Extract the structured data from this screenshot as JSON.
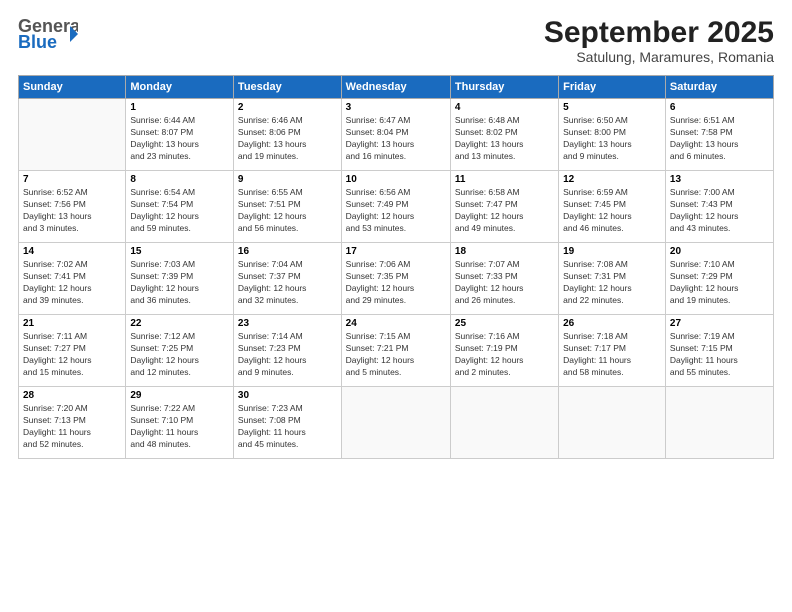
{
  "header": {
    "logo_general": "General",
    "logo_blue": "Blue",
    "title": "September 2025",
    "subtitle": "Satulung, Maramures, Romania"
  },
  "weekdays": [
    "Sunday",
    "Monday",
    "Tuesday",
    "Wednesday",
    "Thursday",
    "Friday",
    "Saturday"
  ],
  "weeks": [
    [
      {
        "day": "",
        "detail": ""
      },
      {
        "day": "1",
        "detail": "Sunrise: 6:44 AM\nSunset: 8:07 PM\nDaylight: 13 hours\nand 23 minutes."
      },
      {
        "day": "2",
        "detail": "Sunrise: 6:46 AM\nSunset: 8:06 PM\nDaylight: 13 hours\nand 19 minutes."
      },
      {
        "day": "3",
        "detail": "Sunrise: 6:47 AM\nSunset: 8:04 PM\nDaylight: 13 hours\nand 16 minutes."
      },
      {
        "day": "4",
        "detail": "Sunrise: 6:48 AM\nSunset: 8:02 PM\nDaylight: 13 hours\nand 13 minutes."
      },
      {
        "day": "5",
        "detail": "Sunrise: 6:50 AM\nSunset: 8:00 PM\nDaylight: 13 hours\nand 9 minutes."
      },
      {
        "day": "6",
        "detail": "Sunrise: 6:51 AM\nSunset: 7:58 PM\nDaylight: 13 hours\nand 6 minutes."
      }
    ],
    [
      {
        "day": "7",
        "detail": "Sunrise: 6:52 AM\nSunset: 7:56 PM\nDaylight: 13 hours\nand 3 minutes."
      },
      {
        "day": "8",
        "detail": "Sunrise: 6:54 AM\nSunset: 7:54 PM\nDaylight: 12 hours\nand 59 minutes."
      },
      {
        "day": "9",
        "detail": "Sunrise: 6:55 AM\nSunset: 7:51 PM\nDaylight: 12 hours\nand 56 minutes."
      },
      {
        "day": "10",
        "detail": "Sunrise: 6:56 AM\nSunset: 7:49 PM\nDaylight: 12 hours\nand 53 minutes."
      },
      {
        "day": "11",
        "detail": "Sunrise: 6:58 AM\nSunset: 7:47 PM\nDaylight: 12 hours\nand 49 minutes."
      },
      {
        "day": "12",
        "detail": "Sunrise: 6:59 AM\nSunset: 7:45 PM\nDaylight: 12 hours\nand 46 minutes."
      },
      {
        "day": "13",
        "detail": "Sunrise: 7:00 AM\nSunset: 7:43 PM\nDaylight: 12 hours\nand 43 minutes."
      }
    ],
    [
      {
        "day": "14",
        "detail": "Sunrise: 7:02 AM\nSunset: 7:41 PM\nDaylight: 12 hours\nand 39 minutes."
      },
      {
        "day": "15",
        "detail": "Sunrise: 7:03 AM\nSunset: 7:39 PM\nDaylight: 12 hours\nand 36 minutes."
      },
      {
        "day": "16",
        "detail": "Sunrise: 7:04 AM\nSunset: 7:37 PM\nDaylight: 12 hours\nand 32 minutes."
      },
      {
        "day": "17",
        "detail": "Sunrise: 7:06 AM\nSunset: 7:35 PM\nDaylight: 12 hours\nand 29 minutes."
      },
      {
        "day": "18",
        "detail": "Sunrise: 7:07 AM\nSunset: 7:33 PM\nDaylight: 12 hours\nand 26 minutes."
      },
      {
        "day": "19",
        "detail": "Sunrise: 7:08 AM\nSunset: 7:31 PM\nDaylight: 12 hours\nand 22 minutes."
      },
      {
        "day": "20",
        "detail": "Sunrise: 7:10 AM\nSunset: 7:29 PM\nDaylight: 12 hours\nand 19 minutes."
      }
    ],
    [
      {
        "day": "21",
        "detail": "Sunrise: 7:11 AM\nSunset: 7:27 PM\nDaylight: 12 hours\nand 15 minutes."
      },
      {
        "day": "22",
        "detail": "Sunrise: 7:12 AM\nSunset: 7:25 PM\nDaylight: 12 hours\nand 12 minutes."
      },
      {
        "day": "23",
        "detail": "Sunrise: 7:14 AM\nSunset: 7:23 PM\nDaylight: 12 hours\nand 9 minutes."
      },
      {
        "day": "24",
        "detail": "Sunrise: 7:15 AM\nSunset: 7:21 PM\nDaylight: 12 hours\nand 5 minutes."
      },
      {
        "day": "25",
        "detail": "Sunrise: 7:16 AM\nSunset: 7:19 PM\nDaylight: 12 hours\nand 2 minutes."
      },
      {
        "day": "26",
        "detail": "Sunrise: 7:18 AM\nSunset: 7:17 PM\nDaylight: 11 hours\nand 58 minutes."
      },
      {
        "day": "27",
        "detail": "Sunrise: 7:19 AM\nSunset: 7:15 PM\nDaylight: 11 hours\nand 55 minutes."
      }
    ],
    [
      {
        "day": "28",
        "detail": "Sunrise: 7:20 AM\nSunset: 7:13 PM\nDaylight: 11 hours\nand 52 minutes."
      },
      {
        "day": "29",
        "detail": "Sunrise: 7:22 AM\nSunset: 7:10 PM\nDaylight: 11 hours\nand 48 minutes."
      },
      {
        "day": "30",
        "detail": "Sunrise: 7:23 AM\nSunset: 7:08 PM\nDaylight: 11 hours\nand 45 minutes."
      },
      {
        "day": "",
        "detail": ""
      },
      {
        "day": "",
        "detail": ""
      },
      {
        "day": "",
        "detail": ""
      },
      {
        "day": "",
        "detail": ""
      }
    ]
  ]
}
